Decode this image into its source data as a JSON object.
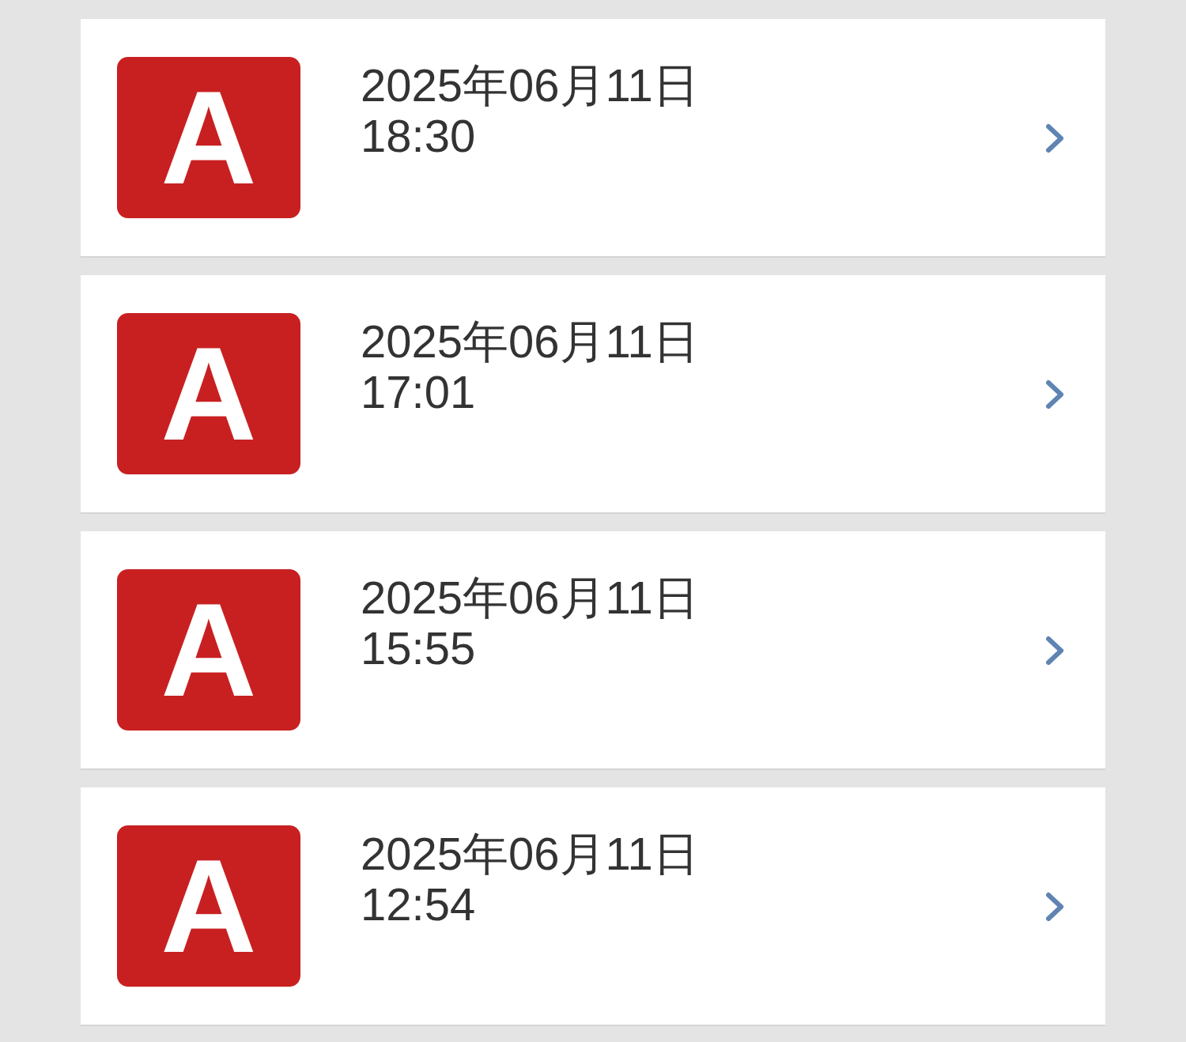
{
  "entries": [
    {
      "badge": "A",
      "date": "2025年06月11日",
      "time": "18:30"
    },
    {
      "badge": "A",
      "date": "2025年06月11日",
      "time": "17:01"
    },
    {
      "badge": "A",
      "date": "2025年06月11日",
      "time": "15:55"
    },
    {
      "badge": "A",
      "date": "2025年06月11日",
      "time": "12:54"
    }
  ]
}
